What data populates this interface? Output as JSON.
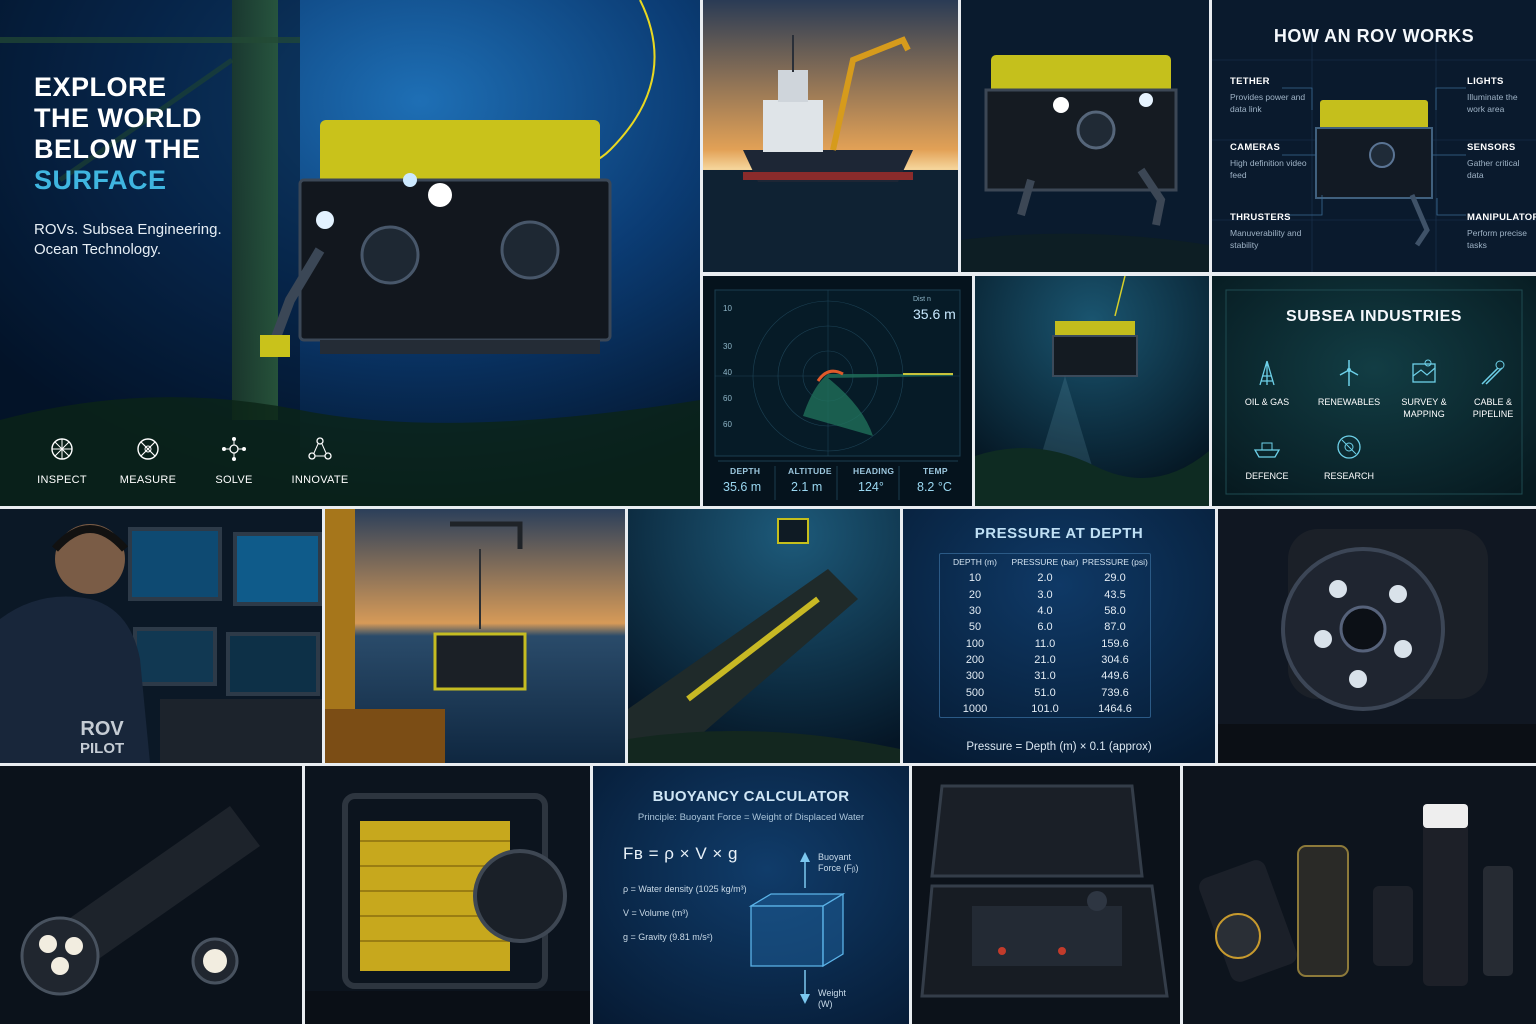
{
  "hero": {
    "title_lines": [
      "EXPLORE",
      "THE WORLD",
      "BELOW THE"
    ],
    "title_accent": "SURFACE",
    "subtitle_lines": [
      "ROVs. Subsea Engineering.",
      "Ocean Technology."
    ],
    "icons": [
      {
        "label": "INSPECT",
        "icon": "crosshair-icon"
      },
      {
        "label": "MEASURE",
        "icon": "compass-icon"
      },
      {
        "label": "SOLVE",
        "icon": "network-icon"
      },
      {
        "label": "INNOVATE",
        "icon": "molecule-icon"
      }
    ]
  },
  "how_rov_works": {
    "title": "HOW AN ROV WORKS",
    "components": [
      {
        "name": "TETHER",
        "desc": "Provides power and data link"
      },
      {
        "name": "CAMERAS",
        "desc": "High definition video feed"
      },
      {
        "name": "THRUSTERS",
        "desc": "Manuverability and stability"
      },
      {
        "name": "LIGHTS",
        "desc": "Illuminate the work area"
      },
      {
        "name": "SENSORS",
        "desc": "Gather critical data"
      },
      {
        "name": "MANIPULATORS",
        "desc": "Perform precise tasks"
      }
    ]
  },
  "sonar": {
    "depth_ticks": [
      "10",
      "30",
      "40",
      "60",
      "60"
    ],
    "top_label": "Dist n",
    "top_value": "35.6 m",
    "readouts": [
      {
        "label": "DEPTH",
        "value": "35.6 m"
      },
      {
        "label": "ALTITUDE",
        "value": "2.1 m"
      },
      {
        "label": "HEADING",
        "value": "124°"
      },
      {
        "label": "TEMP",
        "value": "8.2 °C"
      }
    ]
  },
  "industries": {
    "title": "SUBSEA INDUSTRIES",
    "items": [
      {
        "label_lines": [
          "OIL & GAS"
        ],
        "icon": "oil-rig-icon"
      },
      {
        "label_lines": [
          "RENEWABLES"
        ],
        "icon": "wind-turbine-icon"
      },
      {
        "label_lines": [
          "SURVEY &",
          "MAPPING"
        ],
        "icon": "map-icon"
      },
      {
        "label_lines": [
          "CABLE &",
          "PIPELINE"
        ],
        "icon": "pipeline-icon"
      },
      {
        "label_lines": [
          "DEFENCE"
        ],
        "icon": "ship-icon"
      },
      {
        "label_lines": [
          "RESEARCH"
        ],
        "icon": "atom-icon"
      }
    ]
  },
  "pilot_badge": {
    "line1": "ROV",
    "line2": "PILOT"
  },
  "pressure": {
    "title": "PRESSURE AT DEPTH",
    "headers": [
      "DEPTH (m)",
      "PRESSURE (bar)",
      "PRESSURE (psi)"
    ],
    "rows": [
      [
        "10",
        "2.0",
        "29.0"
      ],
      [
        "20",
        "3.0",
        "43.5"
      ],
      [
        "30",
        "4.0",
        "58.0"
      ],
      [
        "50",
        "6.0",
        "87.0"
      ],
      [
        "100",
        "11.0",
        "159.6"
      ],
      [
        "200",
        "21.0",
        "304.6"
      ],
      [
        "300",
        "31.0",
        "449.6"
      ],
      [
        "500",
        "51.0",
        "739.6"
      ],
      [
        "1000",
        "101.0",
        "1464.6"
      ]
    ],
    "formula": "Pressure = Depth (m) × 0.1 (approx)"
  },
  "buoyancy": {
    "title": "BUOYANCY CALCULATOR",
    "principle": "Principle: Buoyant Force = Weight of Displaced Water",
    "formula": "Fʙ = ρ × V × g",
    "variables": [
      "ρ = Water density (1025 kg/m³)",
      "V = Volume (m³)",
      "g = Gravity (9.81 m/s²)"
    ],
    "force_label": [
      "Buoyant",
      "Force (Fᵦ)"
    ],
    "weight_label": [
      "Weight",
      "(W)"
    ]
  },
  "colors": {
    "accent": "#3fb6e0",
    "rov_yellow": "#d8d21a",
    "deep_blue": "#0a2c55"
  }
}
